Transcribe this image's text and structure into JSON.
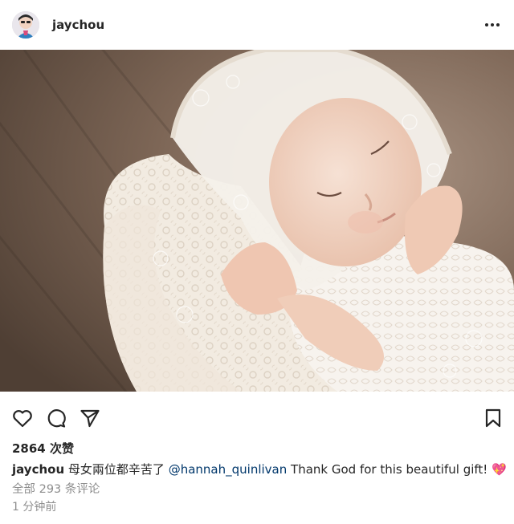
{
  "header": {
    "username": "jaychou",
    "more_icon": "more-horizontal-icon"
  },
  "post": {
    "image_alt": "newborn-baby-photo"
  },
  "actions": {
    "like_icon": "heart-icon",
    "comment_icon": "comment-icon",
    "share_icon": "send-icon",
    "save_icon": "bookmark-icon"
  },
  "likes": {
    "text": "2864 次赞"
  },
  "caption": {
    "username": "jaychou",
    "text_before": "母女兩位都辛苦了",
    "mention": "@hannah_quinlivan",
    "text_after": "Thank God for this beautiful gift!",
    "emoji": "💖"
  },
  "comments": {
    "text": "全部 293 条评论"
  },
  "timestamp": {
    "text": "1 分钟前"
  },
  "colors": {
    "text": "#262626",
    "secondary": "#8e8e8e",
    "mention": "#00376b"
  }
}
